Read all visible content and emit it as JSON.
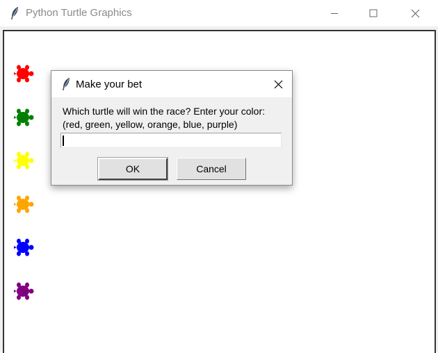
{
  "window": {
    "title": "Python Turtle Graphics",
    "controls": [
      "minimize",
      "maximize",
      "close"
    ]
  },
  "turtles": [
    {
      "color_name": "red",
      "hex": "#ff0000"
    },
    {
      "color_name": "green",
      "hex": "#008000"
    },
    {
      "color_name": "yellow",
      "hex": "#ffff00"
    },
    {
      "color_name": "orange",
      "hex": "#ffa500"
    },
    {
      "color_name": "blue",
      "hex": "#0000ff"
    },
    {
      "color_name": "purple",
      "hex": "#800080"
    }
  ],
  "dialog": {
    "title": "Make your bet",
    "prompt": "Which turtle will win the race? Enter your color:\n(red, green, yellow, orange, blue, purple)",
    "input_value": "",
    "ok_label": "OK",
    "cancel_label": "Cancel"
  },
  "icons": {
    "app": "feather-icon",
    "minimize": "minimize-icon",
    "maximize": "maximize-icon",
    "close": "close-icon"
  }
}
